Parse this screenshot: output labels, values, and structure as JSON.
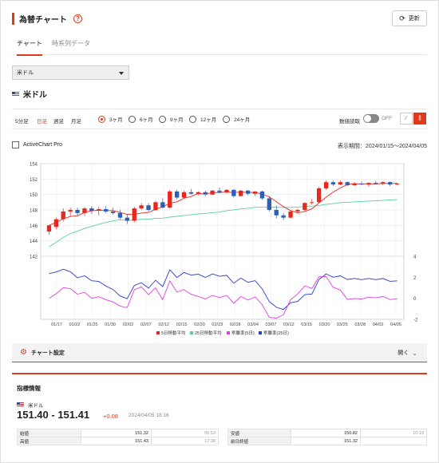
{
  "header": {
    "title": "為替チャート",
    "help_icon": "?",
    "refresh_label": "更新"
  },
  "tabs": [
    {
      "label": "チャート"
    },
    {
      "label": "時系列データ"
    }
  ],
  "currency_select": {
    "value": "米ドル"
  },
  "currency_title": "米ドル",
  "period_buttons": [
    "5分足",
    "日足",
    "週足",
    "月足"
  ],
  "selected_period": "日足",
  "range_options": [
    "3ヶ月",
    "6ヶ月",
    "9ヶ月",
    "12ヶ月",
    "24ヶ月"
  ],
  "selected_range": "3ヶ月",
  "value_read_label": "数値読取",
  "toggle_state": "OFF",
  "activechart_label": "ActiveChart Pro",
  "display_period": "表示期間：2024/01/15〜2024/04/05",
  "chart_data": {
    "type": "candlestick",
    "x_labels": [
      "01/17",
      "01/22",
      "01/25",
      "01/30",
      "02/02",
      "02/07",
      "02/12",
      "02/15",
      "02/20",
      "02/23",
      "02/28",
      "03/04",
      "03/07",
      "03/12",
      "03/15",
      "03/20",
      "03/25",
      "03/28",
      "04/02",
      "04/05"
    ],
    "y_main_ticks": [
      154,
      152,
      150,
      148,
      146,
      144,
      142
    ],
    "y_main_range": [
      142,
      154
    ],
    "y_sub_ticks": [
      4,
      2,
      0,
      -2
    ],
    "y_sub_range": [
      -2,
      4
    ],
    "candles": [
      {
        "o": 145.2,
        "h": 145.6,
        "l": 144.8,
        "c": 146.0
      },
      {
        "o": 145.8,
        "h": 147.0,
        "l": 145.5,
        "c": 146.8
      },
      {
        "o": 146.8,
        "h": 148.2,
        "l": 146.5,
        "c": 147.8
      },
      {
        "o": 147.8,
        "h": 148.3,
        "l": 147.2,
        "c": 148.0
      },
      {
        "o": 148.0,
        "h": 148.3,
        "l": 147.3,
        "c": 147.6
      },
      {
        "o": 147.6,
        "h": 148.4,
        "l": 147.2,
        "c": 148.2
      },
      {
        "o": 148.2,
        "h": 148.5,
        "l": 147.5,
        "c": 147.9
      },
      {
        "o": 147.9,
        "h": 148.4,
        "l": 147.3,
        "c": 148.1
      },
      {
        "o": 148.1,
        "h": 148.5,
        "l": 147.6,
        "c": 147.8
      },
      {
        "o": 147.8,
        "h": 148.3,
        "l": 147.4,
        "c": 147.6
      },
      {
        "o": 147.6,
        "h": 148.0,
        "l": 146.8,
        "c": 147.0
      },
      {
        "o": 147.0,
        "h": 147.4,
        "l": 146.2,
        "c": 146.6
      },
      {
        "o": 146.6,
        "h": 148.4,
        "l": 146.4,
        "c": 148.2
      },
      {
        "o": 148.2,
        "h": 148.9,
        "l": 148.0,
        "c": 148.6
      },
      {
        "o": 148.6,
        "h": 148.9,
        "l": 147.8,
        "c": 148.0
      },
      {
        "o": 148.0,
        "h": 149.2,
        "l": 147.9,
        "c": 149.0
      },
      {
        "o": 149.0,
        "h": 149.5,
        "l": 148.2,
        "c": 148.3
      },
      {
        "o": 148.3,
        "h": 150.6,
        "l": 148.2,
        "c": 150.4
      },
      {
        "o": 150.4,
        "h": 150.6,
        "l": 149.4,
        "c": 149.6
      },
      {
        "o": 149.6,
        "h": 150.5,
        "l": 149.5,
        "c": 150.3
      },
      {
        "o": 150.3,
        "h": 150.7,
        "l": 150.0,
        "c": 150.1
      },
      {
        "o": 150.1,
        "h": 150.4,
        "l": 149.9,
        "c": 150.3
      },
      {
        "o": 150.3,
        "h": 150.5,
        "l": 149.8,
        "c": 150.0
      },
      {
        "o": 150.0,
        "h": 150.6,
        "l": 149.9,
        "c": 150.5
      },
      {
        "o": 150.5,
        "h": 150.9,
        "l": 150.2,
        "c": 150.3
      },
      {
        "o": 150.3,
        "h": 150.7,
        "l": 150.1,
        "c": 150.6
      },
      {
        "o": 150.6,
        "h": 150.7,
        "l": 149.6,
        "c": 149.8
      },
      {
        "o": 149.8,
        "h": 150.6,
        "l": 149.7,
        "c": 150.5
      },
      {
        "o": 150.5,
        "h": 150.6,
        "l": 149.9,
        "c": 150.1
      },
      {
        "o": 150.1,
        "h": 150.4,
        "l": 149.8,
        "c": 150.4
      },
      {
        "o": 150.4,
        "h": 150.5,
        "l": 149.3,
        "c": 149.5
      },
      {
        "o": 149.5,
        "h": 149.8,
        "l": 147.8,
        "c": 148.0
      },
      {
        "o": 148.0,
        "h": 148.6,
        "l": 146.9,
        "c": 147.3
      },
      {
        "o": 147.3,
        "h": 147.6,
        "l": 146.7,
        "c": 147.0
      },
      {
        "o": 147.0,
        "h": 147.9,
        "l": 146.9,
        "c": 147.8
      },
      {
        "o": 147.8,
        "h": 148.2,
        "l": 147.6,
        "c": 148.0
      },
      {
        "o": 148.0,
        "h": 149.0,
        "l": 147.9,
        "c": 148.9
      },
      {
        "o": 148.9,
        "h": 149.4,
        "l": 148.7,
        "c": 149.0
      },
      {
        "o": 149.0,
        "h": 151.0,
        "l": 148.9,
        "c": 150.8
      },
      {
        "o": 150.8,
        "h": 151.8,
        "l": 150.6,
        "c": 151.6
      },
      {
        "o": 151.6,
        "h": 151.8,
        "l": 151.1,
        "c": 151.3
      },
      {
        "o": 151.3,
        "h": 151.8,
        "l": 151.2,
        "c": 151.6
      },
      {
        "o": 151.6,
        "h": 151.7,
        "l": 151.1,
        "c": 151.2
      },
      {
        "o": 151.2,
        "h": 151.6,
        "l": 151.1,
        "c": 151.4
      },
      {
        "o": 151.4,
        "h": 151.7,
        "l": 151.2,
        "c": 151.3
      },
      {
        "o": 151.3,
        "h": 151.6,
        "l": 151.0,
        "c": 151.5
      },
      {
        "o": 151.5,
        "h": 151.8,
        "l": 151.3,
        "c": 151.4
      },
      {
        "o": 151.4,
        "h": 151.7,
        "l": 151.2,
        "c": 151.6
      },
      {
        "o": 151.6,
        "h": 151.7,
        "l": 151.1,
        "c": 151.3
      },
      {
        "o": 151.3,
        "h": 151.5,
        "l": 151.2,
        "c": 151.4
      }
    ],
    "legend": [
      {
        "name": "5日移動平均",
        "color": "#e8281e"
      },
      {
        "name": "25日移動平均",
        "color": "#5ad0a6"
      },
      {
        "name": "乖離率(5日)",
        "color": "#e040e0"
      },
      {
        "name": "乖離率(25日)",
        "color": "#2b3ad0"
      }
    ],
    "up_color": "#e8281e",
    "down_color": "#2b5fb8"
  },
  "settings": {
    "title": "チャート設定",
    "open_label": "開く"
  },
  "indicator": {
    "heading": "指標情報",
    "symbol": "米ドル",
    "price": "151.40 - 151.41",
    "change": "+0.08",
    "timestamp": "2024/04/05 18:16",
    "rows_left": [
      {
        "k": "始値",
        "v": "151.32",
        "t": "05:53"
      },
      {
        "k": "高値",
        "v": "151.43",
        "t": "17:38"
      }
    ],
    "rows_right": [
      {
        "k": "安値",
        "v": "150.82",
        "t": "10:19"
      },
      {
        "k": "前日終値",
        "v": "151.32",
        "t": ""
      }
    ]
  }
}
